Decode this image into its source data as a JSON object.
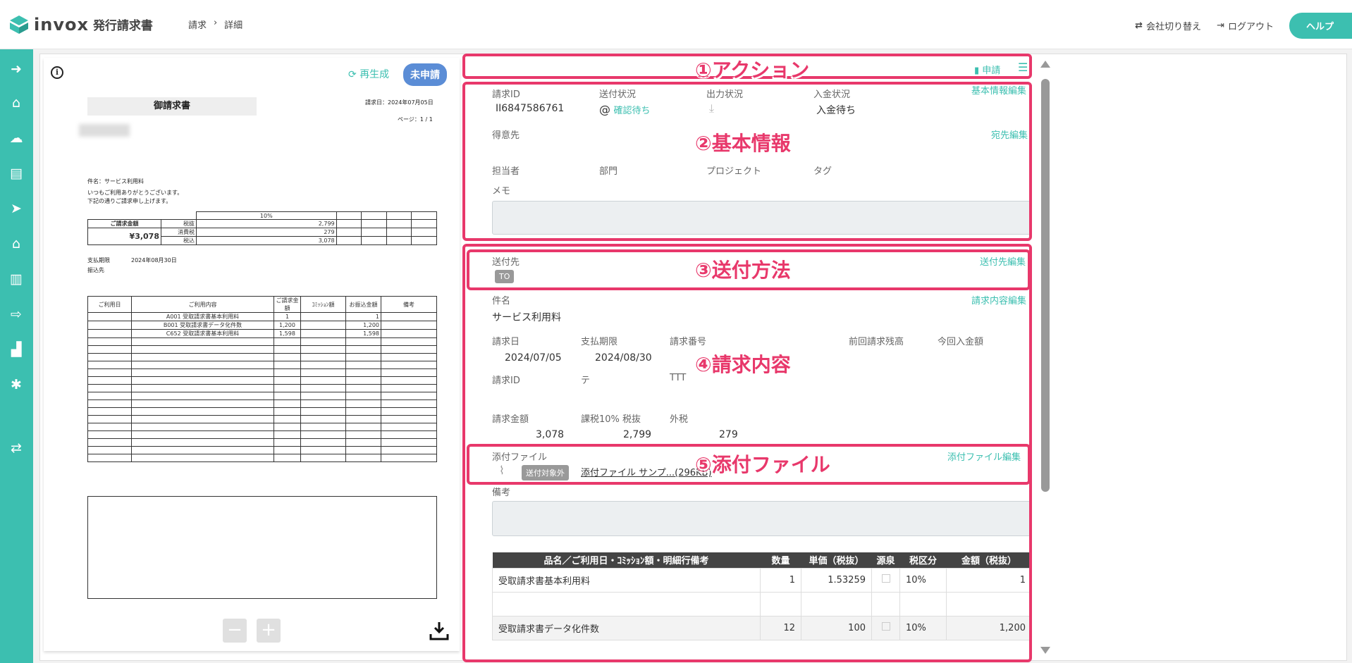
{
  "header": {
    "logo_text": "invox",
    "logo_sub": "発行請求書",
    "breadcrumb": [
      "請求",
      "詳細"
    ],
    "switch_company": "会社切り替え",
    "logout": "ログアウト",
    "help": "ヘルプ"
  },
  "sidebar": {
    "icons": [
      "arrow-right-circle-icon",
      "home-icon",
      "cloud-upload-icon",
      "document-icon",
      "send-icon",
      "bank-icon",
      "building-icon",
      "export-icon",
      "chart-icon",
      "gear-icon",
      "switch-icon"
    ]
  },
  "preview": {
    "regenerate": "再生成",
    "status": "未申請",
    "title": "御請求書",
    "issue_date": "請求日：2024年07月05日",
    "page": "ページ：1 / 1",
    "subject": "件名：サービス利用料",
    "greeting1": "いつもご利用ありがとうございます。",
    "greeting2": "下記の通りご請求申し上げます。",
    "total_label": "ご請求金額",
    "total_value": "¥3,078",
    "tax_rate": "10%",
    "tax_rows": [
      {
        "label": "税抜",
        "value": "2,799"
      },
      {
        "label": "消費税",
        "value": "279"
      },
      {
        "label": "税込",
        "value": "3,078"
      }
    ],
    "due_label": "支払期限",
    "due_value": "2024年08月30日",
    "bank_label": "振込先",
    "line_headers": [
      "ご利用日",
      "ご利用内容",
      "ご請求金額",
      "ｺﾐｯｼｮﾝ額",
      "お振込金額",
      "備考"
    ],
    "lines": [
      {
        "content": "A001 受取請求書基本利用料",
        "amount": "1",
        "pay": "1"
      },
      {
        "content": "B001 受取請求書データ化件数",
        "amount": "1,200",
        "pay": "1,200"
      },
      {
        "content": "C652 受取請求書基本利用料",
        "amount": "1,598",
        "pay": "1,598"
      }
    ]
  },
  "actions": {
    "apply": "申請"
  },
  "basic": {
    "invoice_id_label": "請求ID",
    "invoice_id": "II6847586761",
    "send_status_label": "送付状況",
    "send_status": "確認待ち",
    "output_status_label": "出力状況",
    "payment_status_label": "入金状況",
    "payment_status": "入金待ち",
    "edit": "基本情報編集",
    "customer_label": "得意先",
    "customer_edit": "宛先編集",
    "owner_label": "担当者",
    "dept_label": "部門",
    "project_label": "プロジェクト",
    "tag_label": "タグ",
    "memo_label": "メモ"
  },
  "send": {
    "dest_label": "送付先",
    "to_tag": "TO",
    "edit": "送付先編集"
  },
  "content": {
    "subject_label": "件名",
    "subject": "サービス利用料",
    "edit": "請求内容編集",
    "issue_date_label": "請求日",
    "issue_date": "2024/07/05",
    "due_label": "支払期限",
    "due": "2024/08/30",
    "number_label": "請求番号",
    "prev_balance_label": "前回請求残高",
    "current_paid_label": "今回入金額",
    "id_label": "請求ID",
    "id_val1": "テ",
    "id_val2": "TTT",
    "amount_label": "請求金額",
    "amount": "3,078",
    "taxable_label": "課税10% 税抜",
    "taxable": "2,799",
    "outside_label": "外税",
    "outside": "279"
  },
  "attach": {
    "label": "添付ファイル",
    "edit": "添付ファイル編集",
    "excluded": "送付対象外",
    "file": "添付ファイル サンプ...(296KB)"
  },
  "remarks_label": "備考",
  "items_table": {
    "headers": [
      "品名／ご利用日・ｺﾐｯｼｮﾝ額・明細行備考",
      "数量",
      "単価（税抜）",
      "源泉",
      "税区分",
      "金額（税抜）"
    ],
    "rows": [
      {
        "name": "受取請求書基本利用料",
        "qty": "1",
        "price": "1.53259",
        "tax": "10%",
        "amount": "1"
      },
      {
        "name": "受取請求書データ化件数",
        "qty": "12",
        "price": "100",
        "tax": "10%",
        "amount": "1,200"
      }
    ]
  },
  "callouts": [
    "①アクション",
    "②基本情報",
    "③送付方法",
    "④請求内容",
    "⑤添付ファイル"
  ],
  "colors": {
    "accent": "#3cbfb0",
    "callout": "#e8386b",
    "badge": "#5b8dd6"
  }
}
